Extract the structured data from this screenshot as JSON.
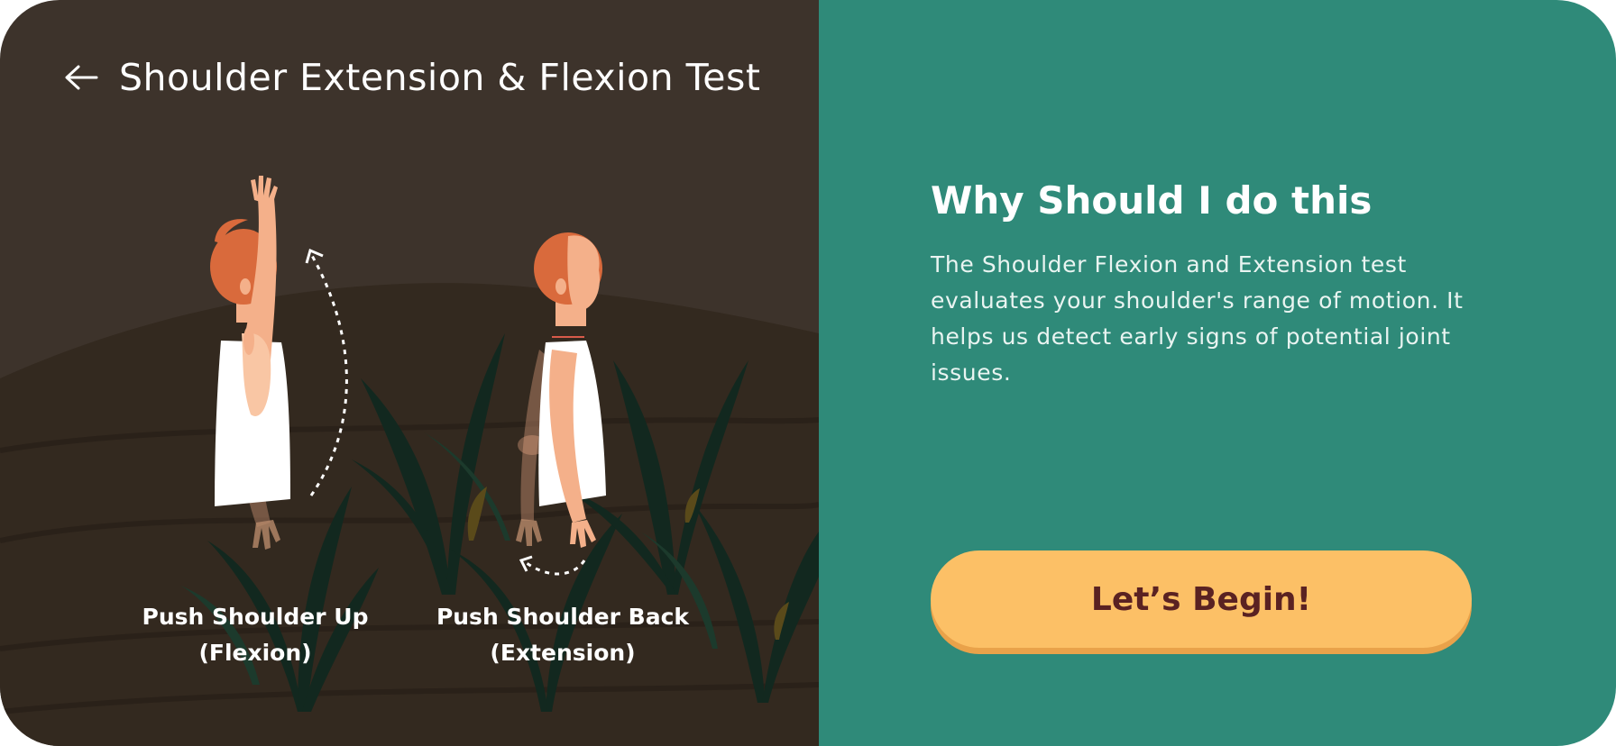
{
  "header": {
    "back_icon": "arrow-left-icon",
    "title": "Shoulder Extension & Flexion Test"
  },
  "illustration": {
    "flexion_caption_line1": "Push Shoulder Up",
    "flexion_caption_line2": "(Flexion)",
    "extension_caption_line1": "Push Shoulder Back",
    "extension_caption_line2": "(Extension)"
  },
  "info": {
    "heading": "Why Should I do this",
    "body": "The Shoulder Flexion and Extension test evaluates your shoulder's range of motion. It helps us detect early signs of potential joint issues."
  },
  "cta": {
    "label": "Let’s Begin!"
  },
  "colors": {
    "left_background": "#3d332b",
    "right_background": "#2f8a79",
    "button": "#fcc066",
    "button_text": "#5a2222"
  }
}
